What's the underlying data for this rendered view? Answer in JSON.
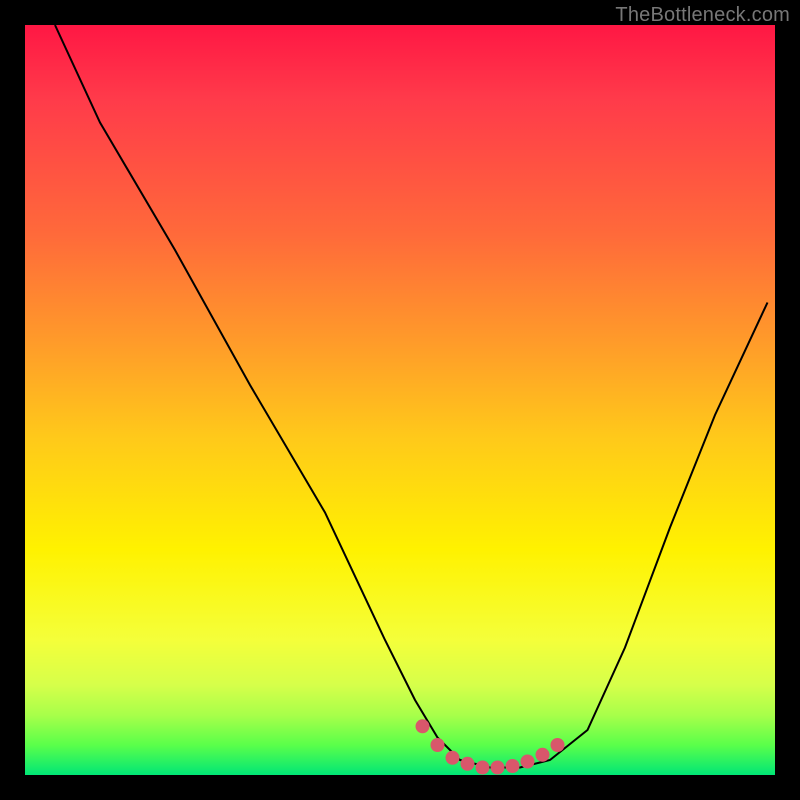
{
  "watermark": "TheBottleneck.com",
  "chart_data": {
    "type": "line",
    "title": "",
    "xlabel": "",
    "ylabel": "",
    "xlim": [
      0,
      100
    ],
    "ylim": [
      0,
      100
    ],
    "series": [
      {
        "name": "bottleneck-curve",
        "x": [
          4,
          10,
          20,
          30,
          40,
          48,
          52,
          55,
          58,
          62,
          66,
          70,
          75,
          80,
          86,
          92,
          99
        ],
        "y": [
          100,
          87,
          70,
          52,
          35,
          18,
          10,
          5,
          2,
          1,
          1,
          2,
          6,
          17,
          33,
          48,
          63
        ]
      }
    ],
    "marker_cluster": {
      "name": "optimal-zone-dots",
      "color": "#d9576b",
      "points": [
        [
          53,
          6.5
        ],
        [
          55,
          4.0
        ],
        [
          57,
          2.3
        ],
        [
          59,
          1.5
        ],
        [
          61,
          1.0
        ],
        [
          63,
          1.0
        ],
        [
          65,
          1.2
        ],
        [
          67,
          1.8
        ],
        [
          69,
          2.7
        ],
        [
          71,
          4.0
        ]
      ]
    },
    "gradient_stops": [
      {
        "pos": 0.0,
        "color": "#ff1744"
      },
      {
        "pos": 0.55,
        "color": "#ffc91a"
      },
      {
        "pos": 0.82,
        "color": "#f4ff3a"
      },
      {
        "pos": 1.0,
        "color": "#00e676"
      }
    ]
  }
}
